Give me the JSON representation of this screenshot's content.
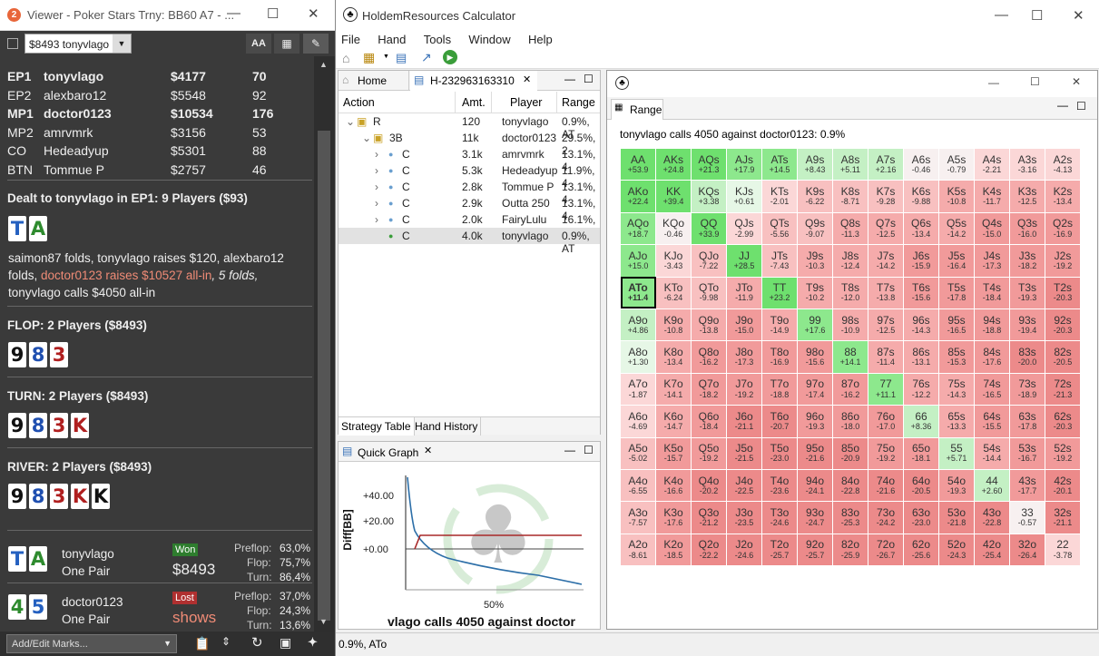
{
  "viewer": {
    "title": "Viewer - Poker Stars Trny: BB60 A7 - ...",
    "select_value": "$8493 tonyvlago",
    "players": [
      {
        "pos": "EP1",
        "name": "tonyvlago",
        "stack": "$4177",
        "bb": "70",
        "bold": true
      },
      {
        "pos": "EP2",
        "name": "alexbaro12",
        "stack": "$5548",
        "bb": "92",
        "bold": false
      },
      {
        "pos": "MP1",
        "name": "doctor0123",
        "stack": "$10534",
        "bb": "176",
        "bold": true
      },
      {
        "pos": "MP2",
        "name": "amrvmrk",
        "stack": "$3156",
        "bb": "53",
        "bold": false
      },
      {
        "pos": "CO",
        "name": "Hedeadyup",
        "stack": "$5301",
        "bb": "88",
        "bold": false
      },
      {
        "pos": "BTN",
        "name": "Tommue P",
        "stack": "$2757",
        "bb": "46",
        "bold": false
      }
    ],
    "dealt_header": "Dealt to tonyvlago in EP1: 9 Players ($93)",
    "hero_cards": [
      "T",
      "A"
    ],
    "action_text_1": "saimon87 folds, tonyvlago raises $120, alexbaro12 folds, ",
    "action_red": "doctor0123 raises $10527 all-in",
    "action_italic": ", 5 folds,",
    "action_text_2": "tonyvlago calls $4050 all-in",
    "flop_header": "FLOP: 2 Players ($8493)",
    "flop_cards": [
      "9",
      "8",
      "3"
    ],
    "turn_header": "TURN: 2 Players ($8493)",
    "turn_cards": [
      "9",
      "8",
      "3",
      "K"
    ],
    "river_header": "RIVER: 2 Players ($8493)",
    "river_cards": [
      "9",
      "8",
      "3",
      "K",
      "K"
    ],
    "results": [
      {
        "cards": [
          "T",
          "A"
        ],
        "name": "tonyvlago",
        "hand": "One Pair",
        "badge": "Won",
        "amount": "$8493",
        "preflop": "63,0%",
        "flop": "75,7%",
        "turn": "86,4%"
      },
      {
        "cards": [
          "4",
          "5"
        ],
        "name": "doctor0123",
        "hand": "One Pair",
        "badge": "Lost",
        "amount": "shows",
        "preflop": "37,0%",
        "flop": "24,3%",
        "turn": "13,6%"
      }
    ],
    "stat_labels": {
      "preflop": "Preflop:",
      "flop": "Flop:",
      "turn": "Turn:"
    },
    "marks_placeholder": "Add/Edit Marks...",
    "aa_label": "AA"
  },
  "hr": {
    "title": "HoldemResources Calculator",
    "menu": [
      "File",
      "Hand",
      "Tools",
      "Window",
      "Help"
    ],
    "tabs": {
      "home": "Home",
      "hand": "H-232963163310"
    },
    "columns": [
      "Action",
      "Amt.",
      "Player",
      "Range"
    ],
    "rows": [
      {
        "action": "R",
        "amt": "120",
        "player": "tonyvlago",
        "range": "0.9%, AT"
      },
      {
        "action": "3B",
        "amt": "11k",
        "player": "doctor0123",
        "range": "29.5%, 2"
      },
      {
        "action": "C",
        "amt": "3.1k",
        "player": "amrvmrk",
        "range": "13.1%, 4"
      },
      {
        "action": "C",
        "amt": "5.3k",
        "player": "Hedeadyup",
        "range": "11.9%, 4"
      },
      {
        "action": "C",
        "amt": "2.8k",
        "player": "Tommue P",
        "range": "13.1%, 4"
      },
      {
        "action": "C",
        "amt": "2.9k",
        "player": "Outta 250",
        "range": "13.1%, 4"
      },
      {
        "action": "C",
        "amt": "2.0k",
        "player": "FairyLulu",
        "range": "16.1%, 2"
      },
      {
        "action": "C",
        "amt": "4.0k",
        "player": "tonyvlago",
        "range": "0.9%, AT"
      }
    ],
    "bottom_tabs": [
      "Strategy Table",
      "Hand History"
    ],
    "quick_graph_title": "Quick Graph",
    "graph": {
      "ylabel": "Diff[BB]",
      "yticks": [
        "+40.00",
        "+20.00",
        "+0.00"
      ],
      "xtick": "50%",
      "caption": "vlago calls 4050 against doctor"
    },
    "status": "0.9%, ATo",
    "range_tab": "Range",
    "range_desc": "tonyvlago calls 4050 against doctor0123: 0.9%",
    "range_grid": [
      [
        "AA|+53.9",
        "AKs|+24.8",
        "AQs|+21.3",
        "AJs|+17.9",
        "ATs|+14.5",
        "A9s|+8.43",
        "A8s|+5.11",
        "A7s|+2.16",
        "A6s|-0.46",
        "A5s|-0.79",
        "A4s|-2.21",
        "A3s|-3.16",
        "A2s|-4.13"
      ],
      [
        "AKo|+22.4",
        "KK|+39.4",
        "KQs|+3.38",
        "KJs|+0.61",
        "KTs|-2.01",
        "K9s|-6.22",
        "K8s|-8.71",
        "K7s|-9.28",
        "K6s|-9.88",
        "K5s|-10.8",
        "K4s|-11.7",
        "K3s|-12.5",
        "K2s|-13.4"
      ],
      [
        "AQo|+18.7",
        "KQo|-0.46",
        "QQ|+33.9",
        "QJs|-2.99",
        "QTs|-5.56",
        "Q9s|-9.07",
        "Q8s|-11.3",
        "Q7s|-12.5",
        "Q6s|-13.4",
        "Q5s|-14.2",
        "Q4s|-15.0",
        "Q3s|-16.0",
        "Q2s|-16.9"
      ],
      [
        "AJo|+15.0",
        "KJo|-3.43",
        "QJo|-7.22",
        "JJ|+28.5",
        "JTs|-7.43",
        "J9s|-10.3",
        "J8s|-12.4",
        "J7s|-14.2",
        "J6s|-15.9",
        "J5s|-16.4",
        "J4s|-17.3",
        "J3s|-18.2",
        "J2s|-19.2"
      ],
      [
        "ATo|+11.4",
        "KTo|-6.24",
        "QTo|-9.98",
        "JTo|-11.9",
        "TT|+23.2",
        "T9s|-10.2",
        "T8s|-12.0",
        "T7s|-13.8",
        "T6s|-15.6",
        "T5s|-17.8",
        "T4s|-18.4",
        "T3s|-19.3",
        "T2s|-20.3"
      ],
      [
        "A9o|+4.86",
        "K9o|-10.8",
        "Q9o|-13.8",
        "J9o|-15.0",
        "T9o|-14.9",
        "99|+17.6",
        "98s|-10.9",
        "97s|-12.5",
        "96s|-14.3",
        "95s|-16.5",
        "94s|-18.8",
        "93s|-19.4",
        "92s|-20.3"
      ],
      [
        "A8o|+1.30",
        "K8o|-13.4",
        "Q8o|-16.2",
        "J8o|-17.3",
        "T8o|-16.9",
        "98o|-15.6",
        "88|+14.1",
        "87s|-11.4",
        "86s|-13.1",
        "85s|-15.3",
        "84s|-17.6",
        "83s|-20.0",
        "82s|-20.5"
      ],
      [
        "A7o|-1.87",
        "K7o|-14.1",
        "Q7o|-18.2",
        "J7o|-19.2",
        "T7o|-18.8",
        "97o|-17.4",
        "87o|-16.2",
        "77|+11.1",
        "76s|-12.2",
        "75s|-14.3",
        "74s|-16.5",
        "73s|-18.9",
        "72s|-21.3"
      ],
      [
        "A6o|-4.69",
        "K6o|-14.7",
        "Q6o|-18.4",
        "J6o|-21.1",
        "T6o|-20.7",
        "96o|-19.3",
        "86o|-18.0",
        "76o|-17.0",
        "66|+8.36",
        "65s|-13.3",
        "64s|-15.5",
        "63s|-17.8",
        "62s|-20.3"
      ],
      [
        "A5o|-5.02",
        "K5o|-15.7",
        "Q5o|-19.2",
        "J5o|-21.5",
        "T5o|-23.0",
        "95o|-21.6",
        "85o|-20.9",
        "75o|-19.2",
        "65o|-18.1",
        "55|+5.71",
        "54s|-14.4",
        "53s|-16.7",
        "52s|-19.2"
      ],
      [
        "A4o|-6.55",
        "K4o|-16.6",
        "Q4o|-20.2",
        "J4o|-22.5",
        "T4o|-23.6",
        "94o|-24.1",
        "84o|-22.8",
        "74o|-21.6",
        "64o|-20.5",
        "54o|-19.3",
        "44|+2.60",
        "43s|-17.7",
        "42s|-20.1"
      ],
      [
        "A3o|-7.57",
        "K3o|-17.6",
        "Q3o|-21.2",
        "J3o|-23.5",
        "T3o|-24.6",
        "93o|-24.7",
        "83o|-25.3",
        "73o|-24.2",
        "63o|-23.0",
        "53o|-21.8",
        "43o|-22.8",
        "33|-0.57",
        "32s|-21.1"
      ],
      [
        "A2o|-8.61",
        "K2o|-18.5",
        "Q2o|-22.2",
        "J2o|-24.6",
        "T2o|-25.7",
        "92o|-25.7",
        "82o|-25.9",
        "72o|-26.7",
        "62o|-25.6",
        "52o|-24.3",
        "42o|-25.4",
        "32o|-26.4",
        "22|-3.78"
      ]
    ],
    "selected_hand": "ATo"
  }
}
